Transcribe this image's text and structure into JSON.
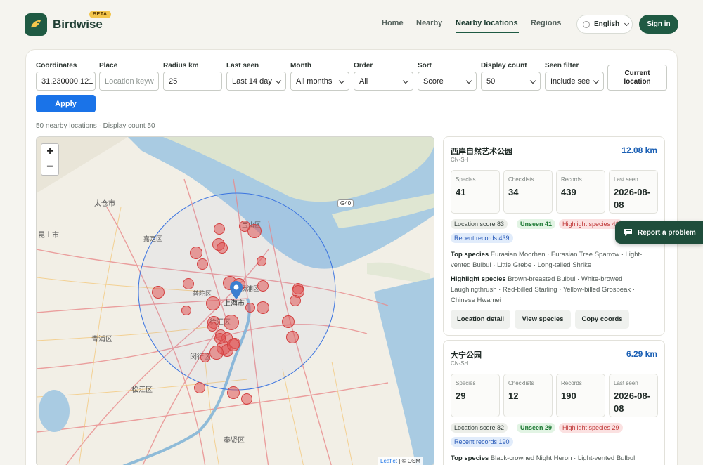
{
  "header": {
    "brand": "Birdwise",
    "badge": "BETA",
    "nav": [
      "Home",
      "Nearby",
      "Nearby locations",
      "Regions"
    ],
    "active_nav": "Nearby locations",
    "language": "English",
    "sign_in": "Sign in"
  },
  "filters": {
    "coordinates": {
      "label": "Coordinates",
      "value": "31.230000,121"
    },
    "place": {
      "label": "Place",
      "placeholder": "Location keyw"
    },
    "radius": {
      "label": "Radius km",
      "value": "25"
    },
    "last_seen": {
      "label": "Last seen",
      "value": "Last 14 day"
    },
    "month": {
      "label": "Month",
      "value": "All months"
    },
    "order": {
      "label": "Order",
      "value": "All"
    },
    "sort": {
      "label": "Sort",
      "value": "Score"
    },
    "display_count": {
      "label": "Display count",
      "value": "50"
    },
    "seen_filter": {
      "label": "Seen filter",
      "value": "Include see"
    },
    "current_location_line1": "Current",
    "current_location_line2": "location",
    "apply": "Apply"
  },
  "summary": "50 nearby locations · Display count 50",
  "map": {
    "zoom_in": "+",
    "zoom_out": "−",
    "attribution_leaflet": "Leaflet",
    "attribution_osm": "| © OSM",
    "labels": [
      "太仓市",
      "昆山市",
      "嘉定区",
      "宝山区",
      "普陀区",
      "上海市",
      "杨浦区",
      "徐汇区",
      "青浦区",
      "闵行区",
      "松江区",
      "奉贤区",
      "G40"
    ]
  },
  "results": [
    {
      "name": "西岸自然艺术公园",
      "region": "CN-SH",
      "distance": "12.08 km",
      "stats": [
        {
          "label": "Species",
          "value": "41"
        },
        {
          "label": "Checklists",
          "value": "34"
        },
        {
          "label": "Records",
          "value": "439"
        },
        {
          "label": "Last seen",
          "value": "2026-08-08"
        }
      ],
      "pills": {
        "score": "Location score 83",
        "unseen": "Unseen 41",
        "highlight": "Highlight species 41",
        "recent": "Recent records 439"
      },
      "top_label": "Top species",
      "top_species": "Eurasian Moorhen · Eurasian Tree Sparrow · Light-vented Bulbul · Little Grebe · Long-tailed Shrike",
      "highlight_label": "Highlight species",
      "highlight_species": "Brown-breasted Bulbul · White-browed Laughingthrush · Red-billed Starling · Yellow-billed Grosbeak · Chinese Hwamei",
      "actions": [
        "Location detail",
        "View species",
        "Copy coords"
      ]
    },
    {
      "name": "大宁公园",
      "region": "CN-SH",
      "distance": "6.29 km",
      "stats": [
        {
          "label": "Species",
          "value": "29"
        },
        {
          "label": "Checklists",
          "value": "12"
        },
        {
          "label": "Records",
          "value": "190"
        },
        {
          "label": "Last seen",
          "value": "2026-08-08"
        }
      ],
      "pills": {
        "score": "Location score 82",
        "unseen": "Unseen 29",
        "highlight": "Highlight species 29",
        "recent": "Recent records 190"
      },
      "top_label": "Top species",
      "top_species": "Black-crowned Night Heron · Light-vented Bulbul"
    }
  ],
  "report": "Report a problem",
  "colors": {
    "brand": "#1f5a43",
    "primary": "#1a73e8",
    "distance": "#1a5fb4",
    "marker": "#e05555"
  }
}
